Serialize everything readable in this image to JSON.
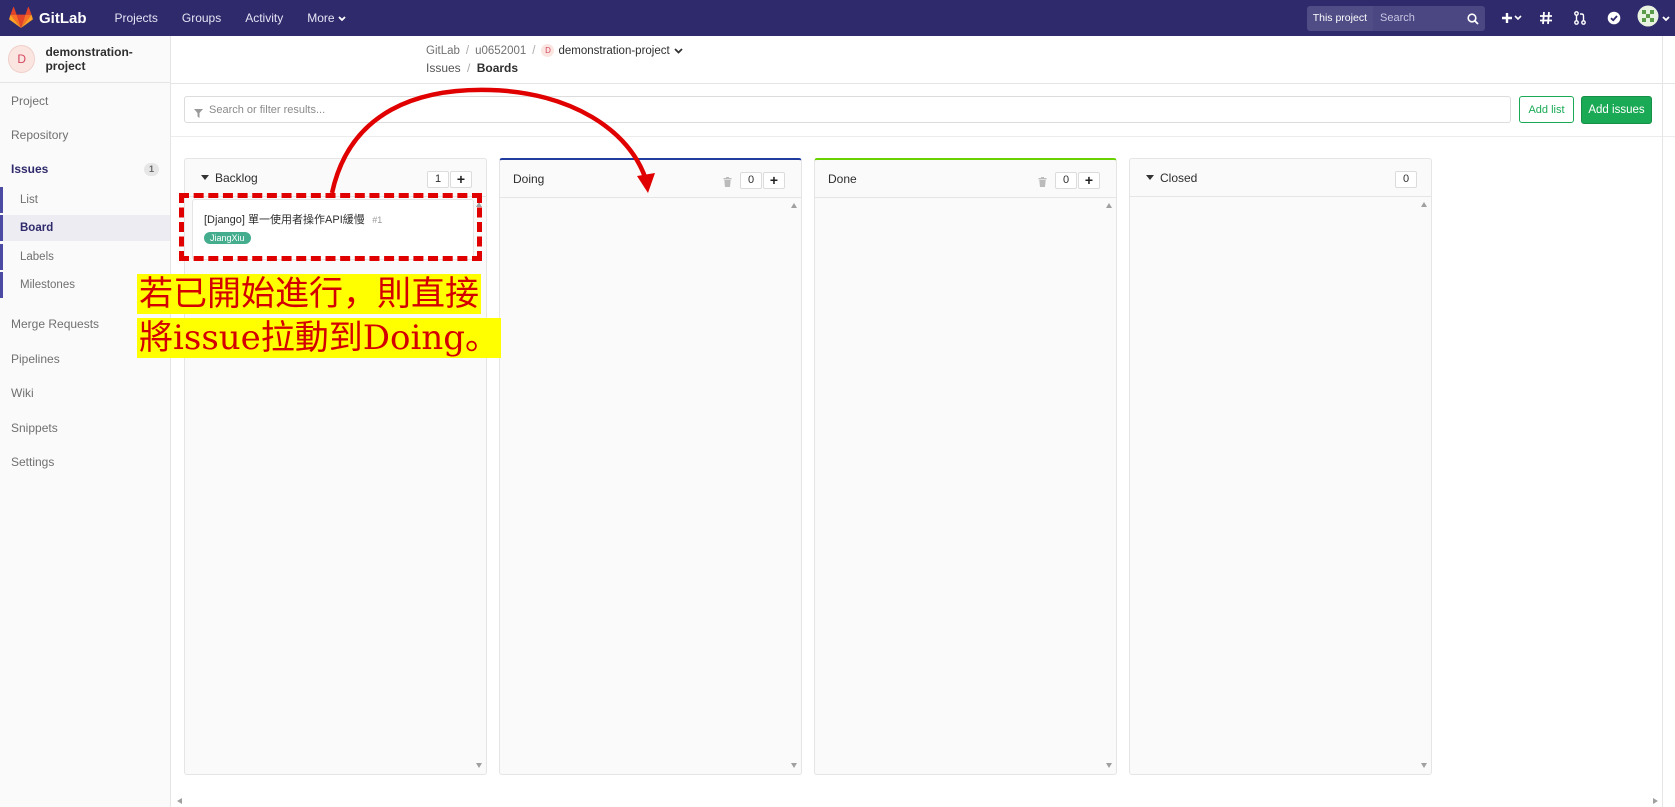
{
  "navbar": {
    "brand": "GitLab",
    "links": [
      "Projects",
      "Groups",
      "Activity",
      "More"
    ],
    "scope": "This project",
    "search_placeholder": "Search",
    "bg_color": "#2f2a6b"
  },
  "sidebar": {
    "project_initial": "D",
    "project_name": "demonstration-project",
    "items": {
      "project": "Project",
      "repository": "Repository",
      "issues": "Issues",
      "issues_count": "1",
      "list": "List",
      "board": "Board",
      "labels": "Labels",
      "milestones": "Milestones",
      "merge_requests": "Merge Requests",
      "pipelines": "Pipelines",
      "wiki": "Wiki",
      "snippets": "Snippets",
      "settings": "Settings"
    }
  },
  "breadcrumb": {
    "root": "GitLab",
    "user": "u0652001",
    "project_initial": "D",
    "project": "demonstration-project",
    "section": "Issues",
    "page": "Boards"
  },
  "filter": {
    "placeholder": "Search or filter results...",
    "add_list": "Add list",
    "add_issues": "Add issues"
  },
  "boards": {
    "backlog": {
      "title": "Backlog",
      "count": "1",
      "accent": ""
    },
    "doing": {
      "title": "Doing",
      "count": "0",
      "accent": "#1f3c9e"
    },
    "done": {
      "title": "Done",
      "count": "0",
      "accent": "#69d100"
    },
    "closed": {
      "title": "Closed",
      "count": "0",
      "accent": ""
    }
  },
  "issue": {
    "title": "[Django] 單一使用者操作API緩慢",
    "number": "#1",
    "label": "JiangXiu",
    "label_color": "#44ad8e"
  },
  "annotation": {
    "line1": "若已開始進行，則直接",
    "line2": "將issue拉動到Doing。",
    "highlight_color": "#ffff00",
    "text_color": "#d40000"
  }
}
